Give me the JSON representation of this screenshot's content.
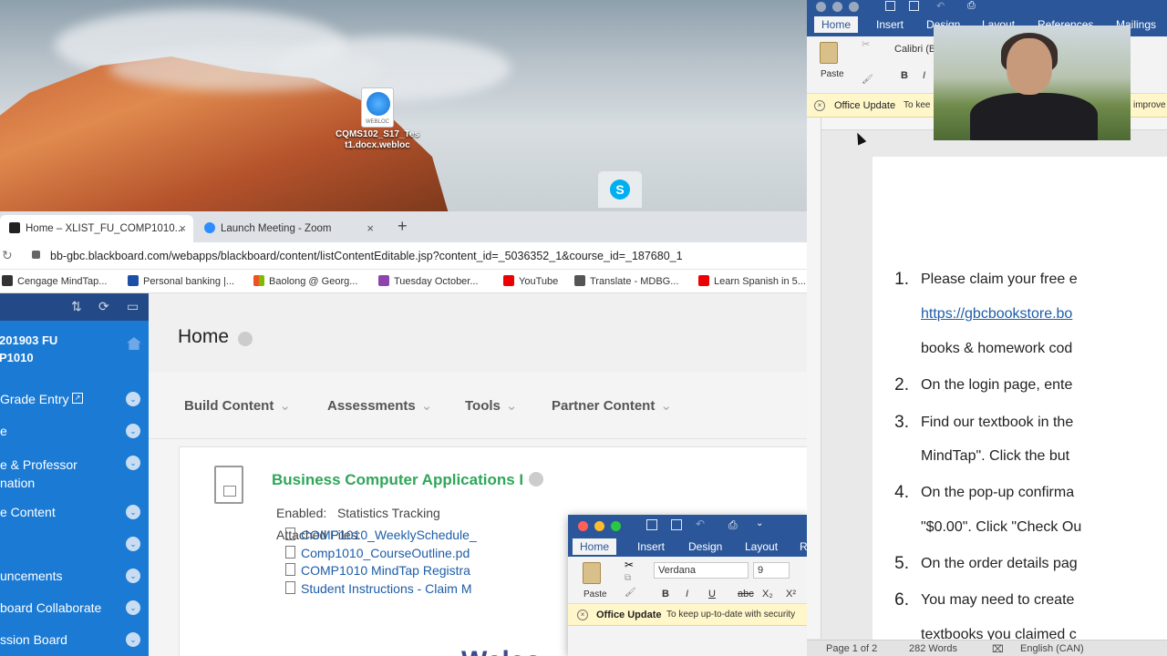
{
  "desktop": {
    "file_icon_tag": "WEBLOC",
    "file_icon_label_line1": "CQMS102_S17_Tes",
    "file_icon_label_line2": "t1.docx.webloc",
    "skype_letter": "S"
  },
  "browser": {
    "tabs": [
      {
        "label": "Home – XLIST_FU_COMP1010...",
        "close": "×"
      },
      {
        "label": "Launch Meeting - Zoom",
        "close": "×"
      }
    ],
    "new_tab": "+",
    "url": "bb-gbc.blackboard.com/webapps/blackboard/content/listContentEditable.jsp?content_id=_5036352_1&course_id=_187680_1",
    "bookmarks": [
      "Cengage MindTap...",
      "Personal banking |...",
      "Baolong @ Georg...",
      "Tuesday October...",
      "YouTube",
      "Translate - MDBG...",
      "Learn Spanish in 5..."
    ]
  },
  "blackboard": {
    "course_line1": "201903 FU",
    "course_line2": "P1010",
    "sidebar": [
      {
        "label": "Grade Entry"
      },
      {
        "label": "e"
      },
      {
        "label": "e & Professor\nnation"
      },
      {
        "label": "e Content"
      },
      {
        "label": ""
      },
      {
        "label": "uncements"
      },
      {
        "label": "board Collaborate"
      },
      {
        "label": "ssion Board"
      }
    ],
    "page_title": "Home",
    "menu": [
      "Build Content",
      "Assessments",
      "Tools",
      "Partner Content"
    ],
    "item_title": "Business Computer Applications I",
    "enabled_label": "Enabled:",
    "enabled_value": "Statistics Tracking",
    "attached_label": "Attached Files:",
    "files": [
      "COMP1010_WeeklySchedule_",
      "Comp1010_CourseOutline.pd",
      "COMP1010 MindTap Registra",
      "Student Instructions - Claim M"
    ],
    "welcome_partial": "Welco"
  },
  "word_small": {
    "tabs": [
      "Home",
      "Insert",
      "Design",
      "Layout",
      "R"
    ],
    "paste": "Paste",
    "font": "Verdana",
    "size": "9",
    "bold": "B",
    "italic": "I",
    "underline": "U",
    "strike": "abc",
    "sub": "X₂",
    "sup": "X²",
    "update_title": "Office Update",
    "update_text": "To keep up-to-date with security"
  },
  "word": {
    "tabs": [
      "Home",
      "Insert",
      "Design",
      "Layout",
      "References",
      "Mailings"
    ],
    "paste": "Paste",
    "font": "Calibri (B",
    "bold": "B",
    "italic": "I",
    "update_title": "Office Update",
    "update_text": "To kee",
    "update_tail": "improve",
    "list": [
      {
        "n": "1.",
        "text": "Please claim your free e"
      },
      {
        "n": "",
        "text": "https://gbcbookstore.bo"
      },
      {
        "n": "",
        "text": "books & homework cod"
      },
      {
        "n": "2.",
        "text": "On the login page, ente"
      },
      {
        "n": "3.",
        "text": "Find our textbook in the"
      },
      {
        "n": "",
        "text": "MindTap\". Click the but"
      },
      {
        "n": "4.",
        "text": "On the pop-up confirma"
      },
      {
        "n": "",
        "text": "\"$0.00\". Click \"Check Ou"
      },
      {
        "n": "5.",
        "text": "On the order details pag"
      },
      {
        "n": "6.",
        "text": "You may need to create"
      },
      {
        "n": "",
        "text": "textbooks you claimed c"
      }
    ],
    "status_page": "Page 1 of 2",
    "status_words": "282 Words",
    "status_lang": "English (CAN)"
  },
  "colors": {
    "word_blue": "#2b579a",
    "bb_blue": "#1a7ad4",
    "bb_green_title": "#2fa65a",
    "link_blue": "#1d5da8"
  }
}
